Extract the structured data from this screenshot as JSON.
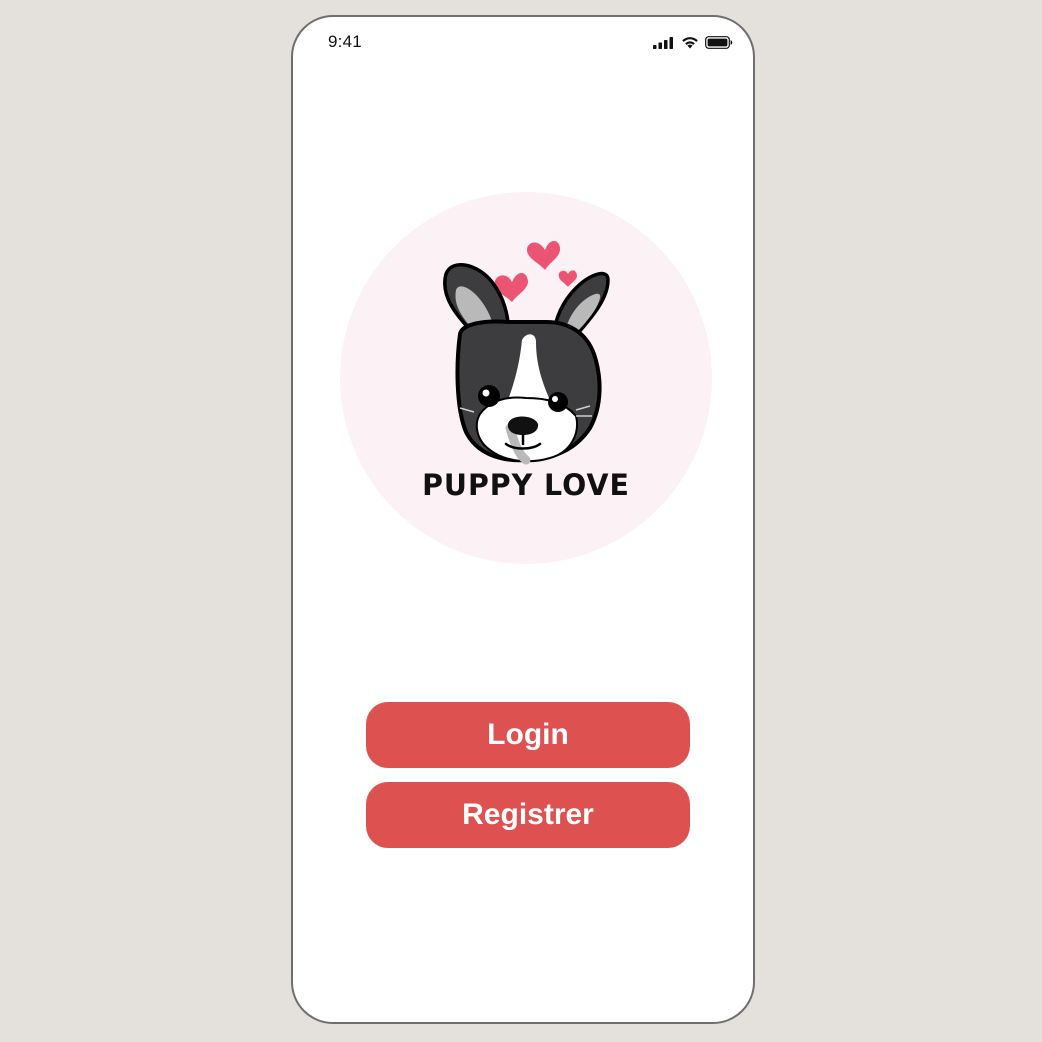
{
  "status_bar": {
    "time": "9:41",
    "icons": [
      "cellular-signal-icon",
      "wifi-icon",
      "battery-icon"
    ]
  },
  "logo": {
    "text": "PUPPY LOVE",
    "illustration": "french-bulldog-with-hearts",
    "colors": {
      "circle_background": "#fcf1f4",
      "heart": "#ec5474",
      "dog_dark": "#3d3d3f",
      "dog_light": "#b9b9b9"
    }
  },
  "actions": {
    "login_label": "Login",
    "register_label": "Registrer"
  },
  "colors": {
    "page_background": "#e4e1dc",
    "screen_background": "#ffffff",
    "button": "#dd5151",
    "button_text": "#ffffff"
  }
}
